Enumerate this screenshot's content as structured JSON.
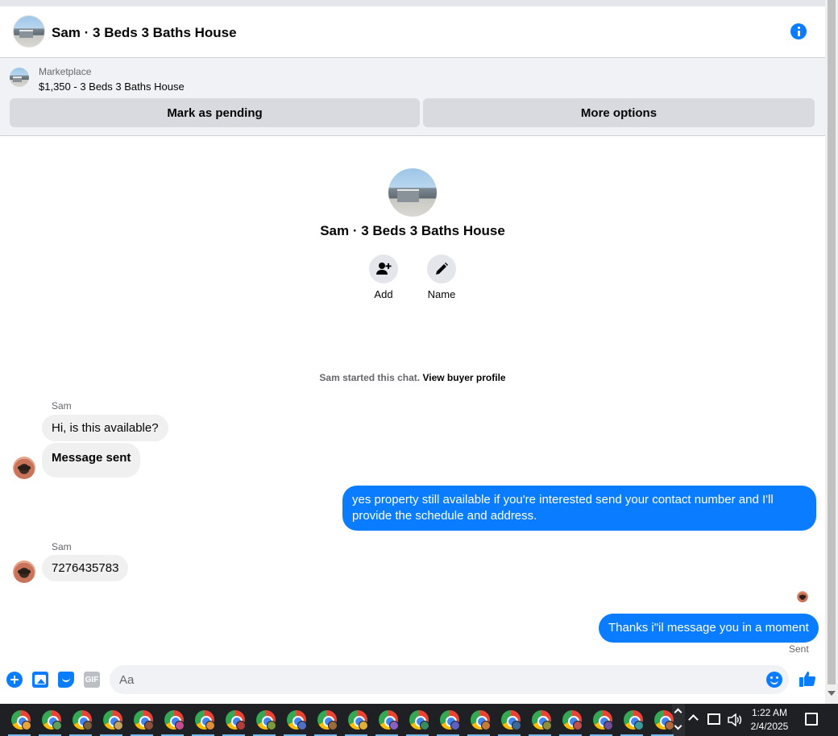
{
  "header": {
    "title": "Sam · 3 Beds 3 Baths House"
  },
  "marketplace": {
    "label": "Marketplace",
    "item": "$1,350 - 3 Beds 3 Baths House",
    "pending_button": "Mark as pending",
    "more_button": "More options"
  },
  "intro": {
    "name": "Sam · 3 Beds 3 Baths House",
    "actions": [
      {
        "label": "Add"
      },
      {
        "label": "Name"
      }
    ]
  },
  "started": {
    "text": "Sam started this chat.",
    "link": "View buyer profile"
  },
  "messages": [
    {
      "sender": "Sam",
      "text": "Hi, is this available?",
      "direction": "in"
    },
    {
      "text": "Message sent",
      "direction": "in"
    },
    {
      "text": "yes property still available if you're interested send your contact number and I'll provide the schedule and address.",
      "direction": "out"
    },
    {
      "sender": "Sam",
      "text": "7276435783",
      "direction": "in"
    },
    {
      "text": "Thanks i\"il message you in a moment",
      "direction": "out"
    }
  ],
  "status": {
    "sent": "Sent"
  },
  "composer": {
    "placeholder": "Aa",
    "gif_label": "GIF"
  },
  "taskbar": {
    "clock_time": "1:22 AM",
    "clock_date": "2/4/2025",
    "chrome_windows": 22,
    "badge_colors": [
      "#e8a33d",
      "#5aa05a",
      "#7a5f3f",
      "#c5a25f",
      "#8d4f3b",
      "#c44d8f",
      "#e08d3a",
      "#b23b3b",
      "#7a9a3b",
      "#4f6fbf",
      "#9a6b3b",
      "#e0b03a",
      "#8a5fbf",
      "#3b8a5f",
      "#5f5fbf",
      "#c47a3a",
      "#3b6a9a",
      "#8f8f3b",
      "#bf4f4f",
      "#6f4f9a",
      "#3b9a9a",
      "#b06a3a"
    ]
  },
  "colors": {
    "messenger_blue": "#0a7cff",
    "bubble_gray": "#f0f0f0",
    "button_gray": "#d8dadf"
  }
}
